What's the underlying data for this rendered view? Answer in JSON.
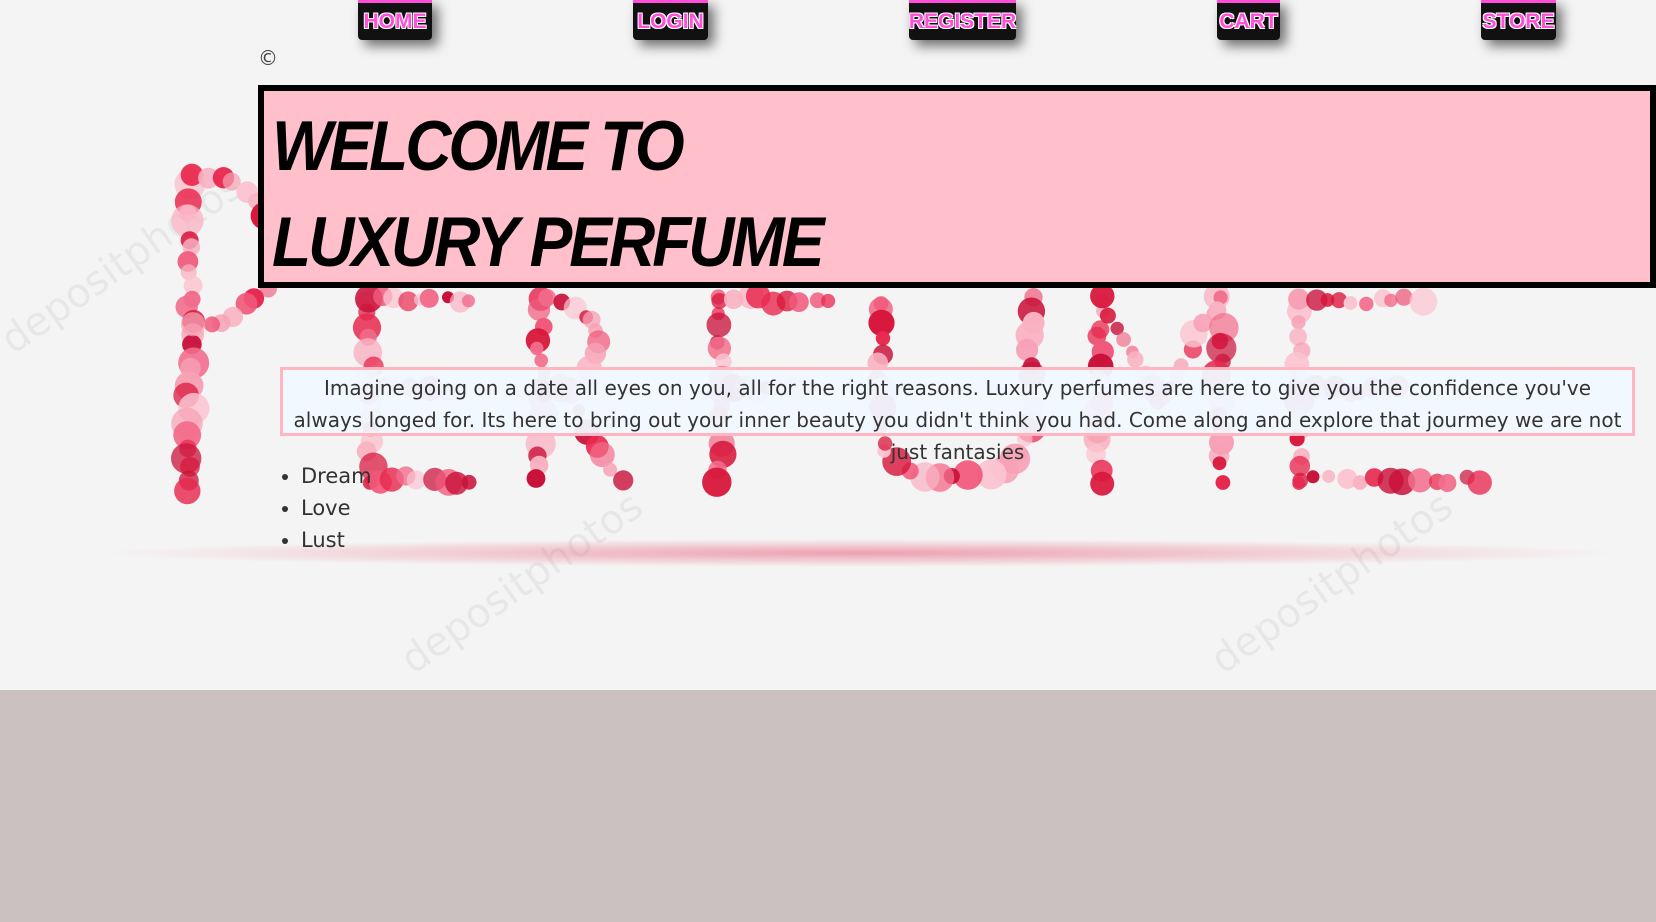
{
  "nav": {
    "home": "HOME",
    "login": "LOGIN",
    "register": "REGISTER",
    "cart": "CART",
    "store": "STORE"
  },
  "copyright": "©",
  "welcome": {
    "line1": "WELCOME TO",
    "line2": "LUXURY PERFUME"
  },
  "intro": "Imagine going on a date all eyes on you, all for the right reasons. Luxury perfumes are here to give you the confidence you've always longed for. Its here to bring out your inner beauty you didn't think you had. Come along and explore that jourmey we are not just fantasies",
  "list": [
    "Dream",
    "Love",
    "Lust"
  ],
  "colors": {
    "nav_text": "#ff4fd8",
    "welcome_bg": "#ffc0cb",
    "page_bg": "#ccc1c1",
    "hero_bg": "#f4f4f4"
  }
}
